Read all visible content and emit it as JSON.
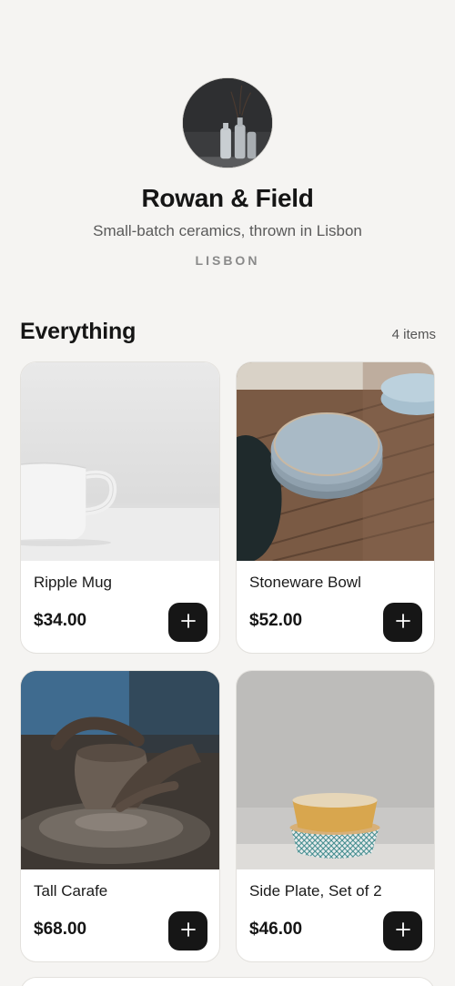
{
  "shop": {
    "name": "Rowan & Field",
    "tagline": "Small-batch ceramics, thrown in Lisbon",
    "location": "LISBON"
  },
  "section": {
    "title": "Everything",
    "count": "4 items"
  },
  "products": [
    {
      "name": "Ripple Mug",
      "price": "$34.00",
      "image": "white-mug"
    },
    {
      "name": "Stoneware Bowl",
      "price": "$52.00",
      "image": "stacked-plates"
    },
    {
      "name": "Tall Carafe",
      "price": "$68.00",
      "image": "pottery-wheel"
    },
    {
      "name": "Side Plate, Set of 2",
      "price": "$46.00",
      "image": "patterned-bowls"
    }
  ],
  "icons": {
    "add": "plus-icon"
  },
  "colors": {
    "background": "#f5f4f2",
    "button": "#161616",
    "card": "#ffffff"
  }
}
